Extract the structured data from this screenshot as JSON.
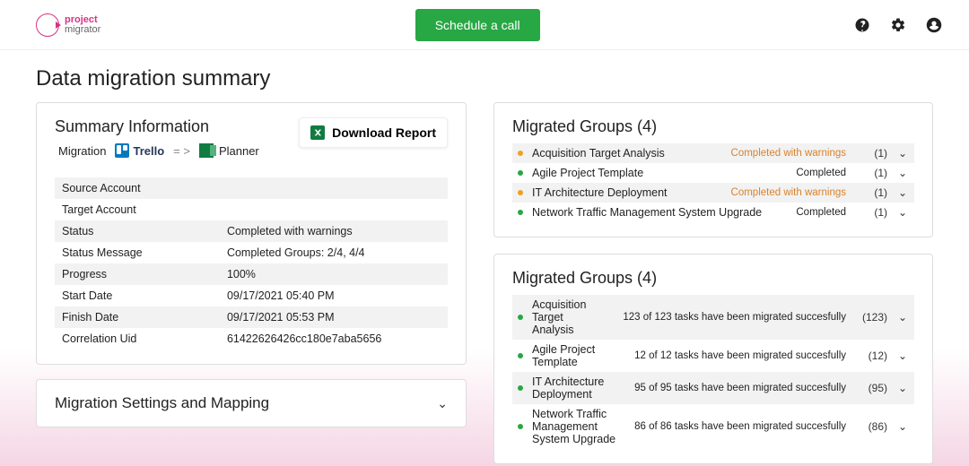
{
  "header": {
    "brand_line1": "project",
    "brand_line2": "migrator",
    "schedule_label": "Schedule a call"
  },
  "page": {
    "title": "Data migration summary"
  },
  "summary": {
    "title": "Summary Information",
    "download_label": "Download Report",
    "migration_label": "Migration",
    "source_label": "Trello",
    "target_label": "Planner",
    "rows": [
      {
        "k": "Source Account",
        "v": ""
      },
      {
        "k": "Target Account",
        "v": ""
      },
      {
        "k": "Status",
        "v": "Completed with warnings"
      },
      {
        "k": "Status Message",
        "v": "Completed Groups: 2/4, 4/4"
      },
      {
        "k": "Progress",
        "v": "100%"
      },
      {
        "k": "Start Date",
        "v": "09/17/2021 05:40 PM"
      },
      {
        "k": "Finish Date",
        "v": "09/17/2021 05:53 PM"
      },
      {
        "k": "Correlation Uid",
        "v": "61422626426cc180e7aba5656"
      }
    ]
  },
  "settings": {
    "title": "Migration Settings and Mapping"
  },
  "groups1": {
    "title": "Migrated Groups (4)",
    "items": [
      {
        "dot": "orange",
        "name": "Acquisition Target Analysis",
        "status": "Completed with warnings",
        "warn": true,
        "count": "(1)"
      },
      {
        "dot": "green",
        "name": "Agile Project Template",
        "status": "Completed",
        "warn": false,
        "count": "(1)"
      },
      {
        "dot": "orange",
        "name": "IT Architecture Deployment",
        "status": "Completed with warnings",
        "warn": true,
        "count": "(1)"
      },
      {
        "dot": "green",
        "name": "Network Traffic Management System Upgrade",
        "status": "Completed",
        "warn": false,
        "count": "(1)"
      }
    ]
  },
  "groups2": {
    "title": "Migrated Groups (4)",
    "items": [
      {
        "dot": "green",
        "name": "Acquisition Target Analysis",
        "status": "123 of 123 tasks have been migrated succesfully",
        "warn": false,
        "count": "(123)"
      },
      {
        "dot": "green",
        "name": "Agile Project Template",
        "status": "12 of 12 tasks have been migrated succesfully",
        "warn": false,
        "count": "(12)"
      },
      {
        "dot": "green",
        "name": "IT Architecture Deployment",
        "status": "95 of 95 tasks have been migrated succesfully",
        "warn": false,
        "count": "(95)"
      },
      {
        "dot": "green",
        "name": "Network Traffic Management System Upgrade",
        "status": "86 of 86 tasks have been migrated succesfully",
        "warn": false,
        "count": "(86)"
      }
    ]
  }
}
